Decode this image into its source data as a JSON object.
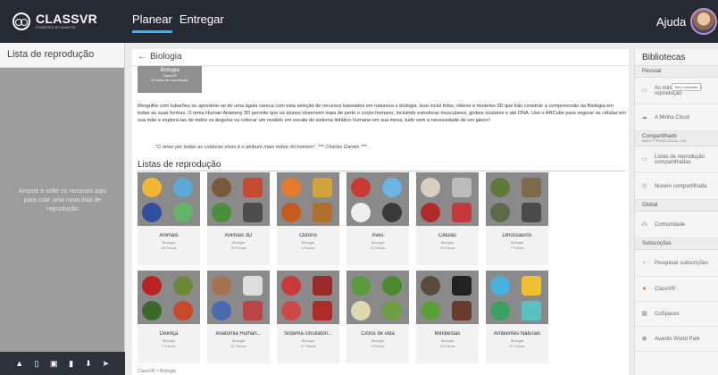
{
  "app": {
    "logo_name": "CLASSVR",
    "logo_sub": "POWERED BY AVANTIS"
  },
  "nav": {
    "tabs": [
      {
        "label": "Planear",
        "active": true
      },
      {
        "label": "Entregar",
        "active": false
      }
    ],
    "help": "Ajuda"
  },
  "colors": {
    "topbar": "#262b33",
    "accent": "#5aa9d6"
  },
  "left": {
    "title": "Lista de reprodução",
    "hint": "Arraste e solte os recursos aqui para criar uma nova lista de reprodução",
    "toolbar_icons": [
      "user-icon",
      "copy-icon",
      "save-icon",
      "delete-icon",
      "download-icon",
      "send-icon"
    ]
  },
  "main": {
    "title": "Biologia",
    "hero": {
      "title": "Biologia",
      "owner": "ClassVR",
      "count": "24 listas de reprodução"
    },
    "description": "Mergulhe com tubarões ou aproxime-se de uma águia careca com esta seleção de recursos baseados em natureza e biologia. Isso inclui fotos, vídeos e modelos 3D que irão construir a compreensão da Biologia em todas as suas formas. O tema Human Anatomy 3D permite que os alunos observem mais de perto o corpo humano, incluindo estruturas musculares, globos oculares e até DNA. Use o ARCube para segurar as células em sua mão e explorá-las de todos os ângulos ou colocar um modelo em escala do sistema linfático humano em sua mesa, tudo sem a necessidade de um jaleco!",
    "quote": "\"O amor por todas as criaturas vivas é o atributo mais nobre do homem\". *** Charles Darwin ***",
    "section_title": "Listas de reprodução",
    "breadcrumb": "ClassVR > Biologia",
    "cards": [
      {
        "name": "Animais",
        "category": "Biologia",
        "count": "16 Faixas"
      },
      {
        "name": "Animais 3D",
        "category": "Biologia",
        "count": "29 Faixas"
      },
      {
        "name": "Outono",
        "category": "Biologia",
        "count": "6 Faixas"
      },
      {
        "name": "Aves",
        "category": "Biologia",
        "count": "11 Faixas"
      },
      {
        "name": "Células",
        "category": "Biologia",
        "count": "15 Faixas"
      },
      {
        "name": "Dinossauros",
        "category": "Biologia",
        "count": "7 Faixas"
      },
      {
        "name": "Doença",
        "category": "Biologia",
        "count": "7 Faixas"
      },
      {
        "name": "Anatomia Human...",
        "category": "Biologia",
        "count": "22 Faixas"
      },
      {
        "name": "Sistema circulatóri...",
        "category": "Biologia",
        "count": "11 Faixas"
      },
      {
        "name": "Ciclos de vida",
        "category": "Biologia",
        "count": "5 Faixas"
      },
      {
        "name": "Minibestas",
        "category": "Biologia",
        "count": "10 Faixas"
      },
      {
        "name": "Ambientes Naturais",
        "category": "Biologia",
        "count": "20 Faixas"
      }
    ]
  },
  "right": {
    "title": "Bibliotecas",
    "tooltip": "Meu conteúdo",
    "sections": [
      {
        "label": "Pessoal",
        "sub": "",
        "items": [
          {
            "label": "As minhas vistas de reprodução",
            "icon": "folder-icon"
          },
          {
            "label": "A Minha Cloud",
            "icon": "cloud-icon"
          }
        ]
      },
      {
        "label": "Compartilhado",
        "sub": "MAKE IT PEDAGOGICAL, LDA",
        "items": [
          {
            "label": "Listas de reprodução compartilhadas",
            "icon": "shared-folder-icon"
          },
          {
            "label": "Nuvem compartilhada",
            "icon": "shared-cloud-icon"
          }
        ]
      },
      {
        "label": "Global",
        "sub": "",
        "items": [
          {
            "label": "Comunidade",
            "icon": "community-icon"
          }
        ]
      },
      {
        "label": "Subscrições",
        "sub": "",
        "items": [
          {
            "label": "Pesquisar subscrições",
            "icon": "search-icon"
          },
          {
            "label": "ClassVR",
            "icon": "classvr-icon"
          },
          {
            "label": "CoSpaces",
            "icon": "cospaces-icon"
          },
          {
            "label": "Avantis World Park",
            "icon": "avantis-icon"
          }
        ]
      }
    ]
  }
}
